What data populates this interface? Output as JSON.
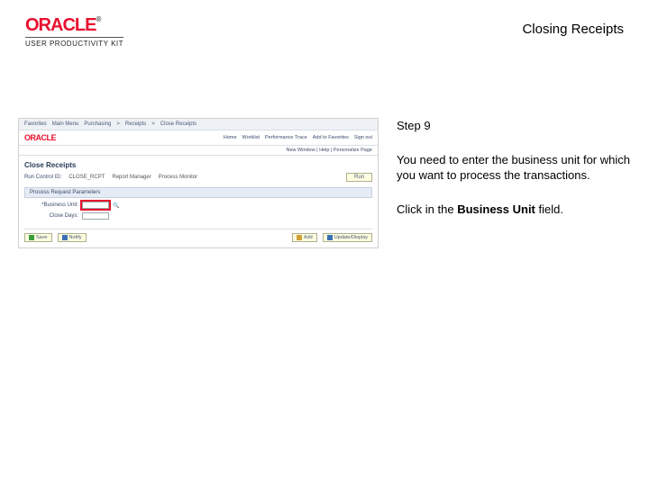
{
  "header": {
    "brand": "ORACLE",
    "brand_tm": "®",
    "subbrand": "USER PRODUCTIVITY KIT",
    "doc_title": "Closing Receipts"
  },
  "instructions": {
    "step_label": "Step 9",
    "para1": "You need to enter the business unit for which you want to process the transactions.",
    "para2_pre": "Click in the ",
    "para2_bold": "Business Unit",
    "para2_post": " field."
  },
  "screenshot": {
    "nav": {
      "left": [
        "Favorites",
        "Main Menu",
        "Purchasing",
        "Receipts",
        "Close Receipts"
      ],
      "right": []
    },
    "toplinks": [
      "Home",
      "Worklist",
      "Performance Trace",
      "Add to Favorites",
      "Sign out"
    ],
    "subbar": "New Window | Help | Personalize Page",
    "page_title": "Close Receipts",
    "run_control_label": "Run Control ID:",
    "run_control_value": "CLOSE_RCPT",
    "report_mgr": "Report Manager",
    "process_monitor": "Process Monitor",
    "run_btn": "Run",
    "section": "Process Request Parameters",
    "fields": {
      "bu_label": "*Business Unit:",
      "days_label": "Close Days:"
    },
    "actions": {
      "save": "Save",
      "notify": "Notify",
      "add": "Add",
      "update": "Update/Display"
    }
  }
}
